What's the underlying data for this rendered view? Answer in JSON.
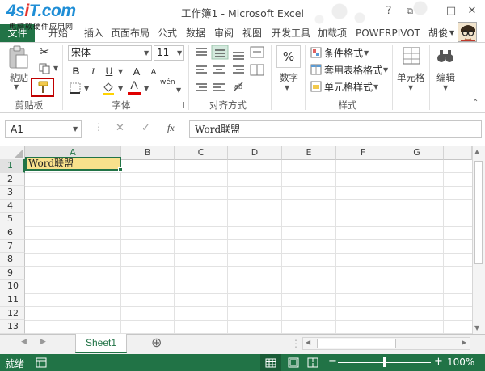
{
  "logo": {
    "text_main": "4s",
    "text_accent": "i",
    "text_end": "T.com",
    "subtitle": "电脑软硬件应用网"
  },
  "window": {
    "title": "工作簿1 - Microsoft Excel",
    "help": "?",
    "restore": "⧉",
    "minimize": "—",
    "maximize": "□",
    "close": "✕"
  },
  "tabs": {
    "file": "文件",
    "home": "开始",
    "insert": "插入",
    "page_layout": "页面布局",
    "formulas": "公式",
    "data": "数据",
    "review": "审阅",
    "view": "视图",
    "developer": "开发工具",
    "addins": "加载项",
    "powerpivot": "POWERPIVOT",
    "user": "胡俊"
  },
  "ribbon": {
    "clipboard": {
      "paste": "粘贴",
      "label": "剪贴板"
    },
    "font": {
      "name": "宋体",
      "size": "11",
      "bold": "B",
      "italic": "I",
      "underline": "U",
      "grow": "A",
      "shrink": "A",
      "font_color": "A",
      "phonetic": "wén",
      "label": "字体"
    },
    "alignment": {
      "label": "对齐方式"
    },
    "number": {
      "percent": "%",
      "label_btn": "数字"
    },
    "styles": {
      "conditional": "条件格式",
      "table": "套用表格格式",
      "cell_styles": "单元格样式",
      "label": "样式"
    },
    "cells": {
      "label": "单元格"
    },
    "editing": {
      "label": "编辑"
    }
  },
  "formula_bar": {
    "name_box": "A1",
    "cancel": "✕",
    "enter": "✓",
    "fx": "fx",
    "value": "Word联盟"
  },
  "grid": {
    "columns": [
      "A",
      "B",
      "C",
      "D",
      "E",
      "F",
      "G"
    ],
    "rows": [
      "1",
      "2",
      "3",
      "4",
      "5",
      "6",
      "7",
      "8",
      "9",
      "10",
      "11",
      "12",
      "13"
    ],
    "active_cell_value": "Word联盟"
  },
  "sheets": {
    "tabs": [
      "Sheet1"
    ],
    "add": "⊕"
  },
  "status": {
    "mode": "就绪",
    "zoom_percent": "100%",
    "zoom_minus": "−",
    "zoom_plus": "+"
  },
  "colors": {
    "accent": "#217346",
    "active_cell_fill": "#f8e18c",
    "highlight_box": "#c00000"
  }
}
